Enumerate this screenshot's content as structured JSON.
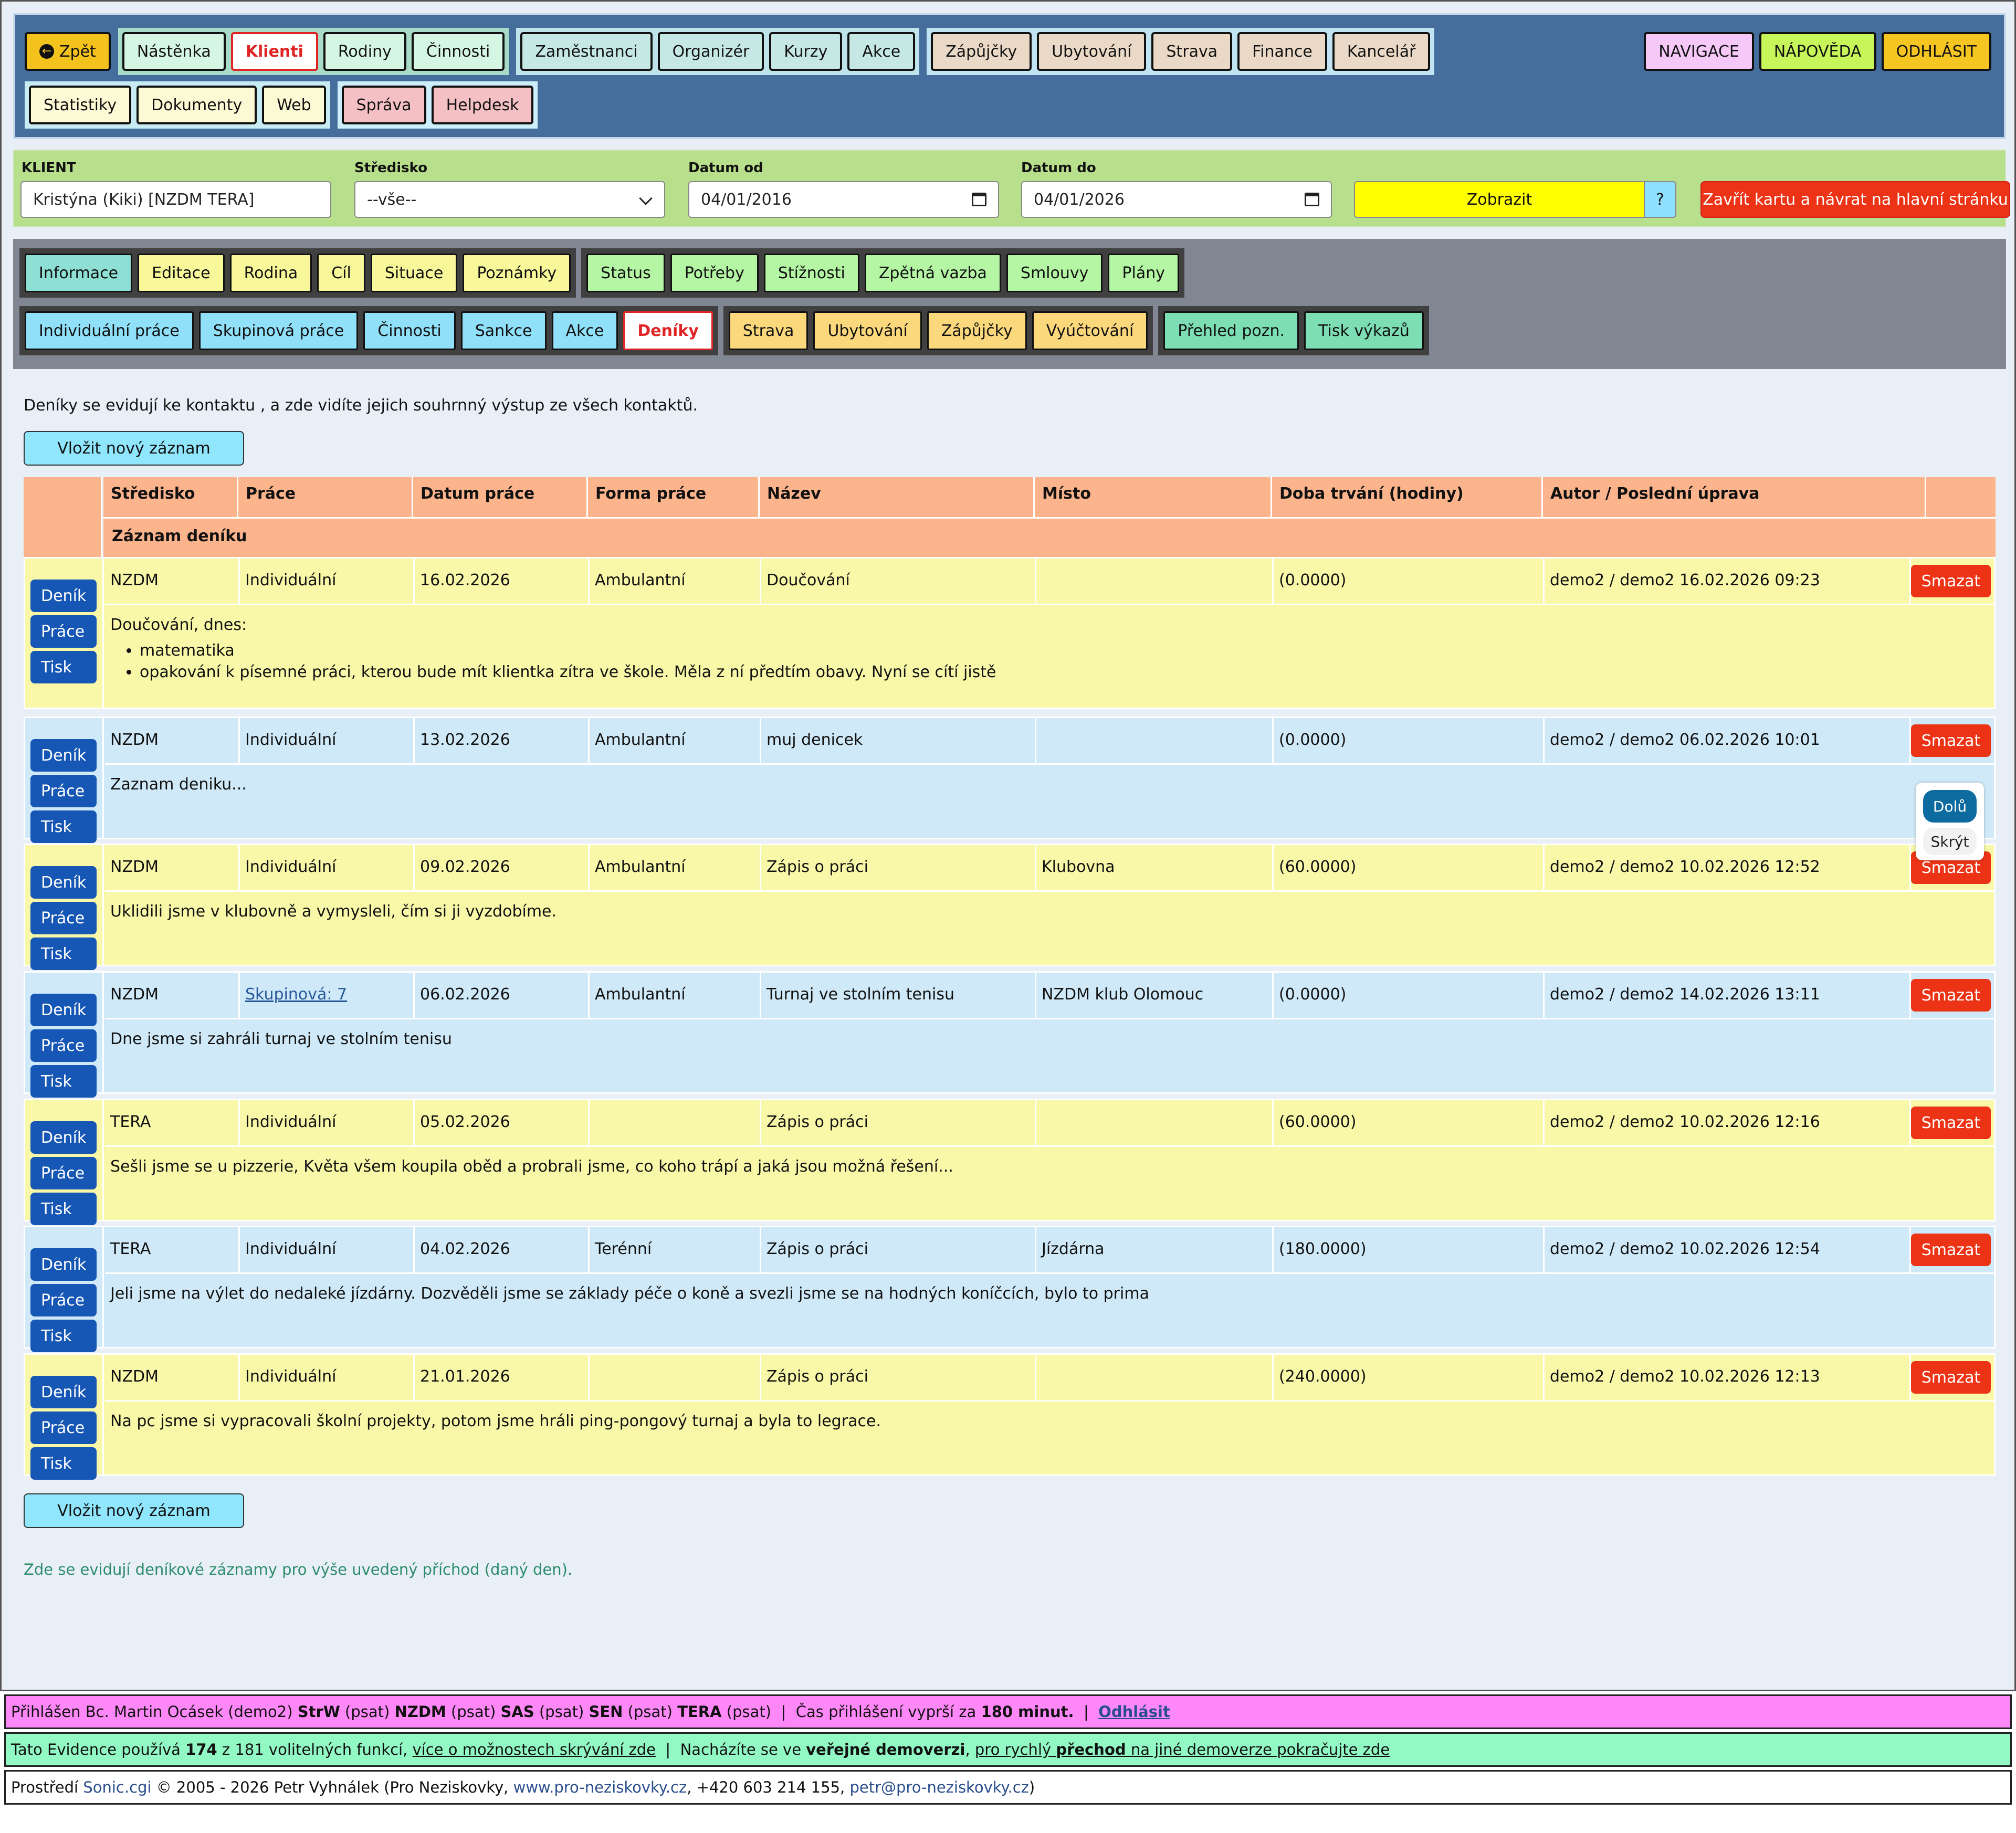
{
  "topnav": {
    "back_label": "Zpět",
    "group1": [
      "Nástěnka",
      "Klienti",
      "Rodiny",
      "Činnosti"
    ],
    "group2": [
      "Zaměstnanci",
      "Organizér",
      "Kurzy",
      "Akce"
    ],
    "group3": [
      "Zápůjčky",
      "Ubytování",
      "Strava",
      "Finance",
      "Kancelář"
    ],
    "row2_group1": [
      "Statistiky",
      "Dokumenty",
      "Web"
    ],
    "row2_group2": [
      "Správa",
      "Helpdesk"
    ],
    "right": [
      "NAVIGACE",
      "NÁPOVĚDA",
      "ODHLÁSIT"
    ]
  },
  "filter": {
    "client_label": "KLIENT",
    "client_value": "Kristýna (Kiki) [NZDM TERA]",
    "center_label": "Středisko",
    "center_value": "--vše--",
    "date_from_label": "Datum od",
    "date_from_value": "04/01/2016",
    "date_to_label": "Datum do",
    "date_to_value": "04/01/2026",
    "show_button": "Zobrazit",
    "help_button": "?",
    "close_button": "Zavřít kartu a návrat na hlavní stránku"
  },
  "tabs": {
    "row1_group1": [
      "Informace",
      "Editace",
      "Rodina",
      "Cíl",
      "Situace",
      "Poznámky"
    ],
    "row1_group2": [
      "Status",
      "Potřeby",
      "Stížnosti",
      "Zpětná vazba",
      "Smlouvy",
      "Plány"
    ],
    "row2_group1": [
      "Individuální práce",
      "Skupinová práce",
      "Činnosti",
      "Sankce",
      "Akce",
      "Deníky"
    ],
    "row2_group2": [
      "Strava",
      "Ubytování",
      "Zápůjčky",
      "Vyúčtování"
    ],
    "row2_group3": [
      "Přehled pozn.",
      "Tisk výkazů"
    ]
  },
  "main": {
    "intro": "Deníky se evidují ke kontaktu , a zde vidíte jejich souhrnný výstup ze všech kontaktů.",
    "insert_button": "Vložit nový záznam",
    "footnote": "Zde se evidují deníkové záznamy pro výše uvedený příchod (daný den)."
  },
  "table": {
    "headers": [
      "Středisko",
      "Práce",
      "Datum práce",
      "Forma práce",
      "Název",
      "Místo",
      "Doba trvání (hodiny)",
      "Autor / Poslední úprava"
    ],
    "subheader": "Záznam deníku",
    "side_buttons": [
      "Deník",
      "Práce",
      "Tisk"
    ],
    "delete_label": "Smazat",
    "rows": [
      {
        "center": "NZDM",
        "work": "Individuální",
        "date": "16.02.2026",
        "form": "Ambulantní",
        "name": "Doučování",
        "place": "",
        "duration": "(0.0000)",
        "author": "demo2 / demo2 16.02.2026 09:23",
        "text": "Doučování, dnes:",
        "bullets": [
          "matematika",
          "opakování k písemné práci, kterou bude mít klientka zítra ve škole. Měla z ní předtím obavy. Nyní se cítí jistě"
        ]
      },
      {
        "center": "NZDM",
        "work": "Individuální",
        "date": "13.02.2026",
        "form": "Ambulantní",
        "name": "muj denicek",
        "place": "",
        "duration": "(0.0000)",
        "author": "demo2 / demo2 06.02.2026 10:01",
        "text": "Zaznam deniku..."
      },
      {
        "center": "NZDM",
        "work": "Individuální",
        "date": "09.02.2026",
        "form": "Ambulantní",
        "name": "Zápis o práci",
        "place": "Klubovna",
        "duration": "(60.0000)",
        "author": "demo2 / demo2 10.02.2026 12:52",
        "text": "Uklidili jsme v klubovně a vymysleli, čím si ji vyzdobíme."
      },
      {
        "center": "NZDM",
        "work": "Skupinová: 7",
        "date": "06.02.2026",
        "form": "Ambulantní",
        "name": "Turnaj ve stolním tenisu",
        "place": "NZDM klub Olomouc",
        "duration": "(0.0000)",
        "author": "demo2 / demo2 14.02.2026 13:11",
        "text": "Dne jsme si zahráli turnaj ve stolním tenisu"
      },
      {
        "center": "TERA",
        "work": "Individuální",
        "date": "05.02.2026",
        "form": "",
        "name": "Zápis o práci",
        "place": "",
        "duration": "(60.0000)",
        "author": "demo2 / demo2 10.02.2026 12:16",
        "text": "Sešli jsme se u pizzerie, Květa všem koupila oběd a probrali jsme, co koho trápí a jaká jsou možná řešení..."
      },
      {
        "center": "TERA",
        "work": "Individuální",
        "date": "04.02.2026",
        "form": "Terénní",
        "name": "Zápis o práci",
        "place": "Jízdárna",
        "duration": "(180.0000)",
        "author": "demo2 / demo2 10.02.2026 12:54",
        "text": "Jeli jsme na výlet do nedaleké jízdárny. Dozvěděli jsme se základy péče o koně a svezli jsme se na hodných koníčcích, bylo to prima"
      },
      {
        "center": "NZDM",
        "work": "Individuální",
        "date": "21.01.2026",
        "form": "",
        "name": "Zápis o práci",
        "place": "",
        "duration": "(240.0000)",
        "author": "demo2 / demo2 10.02.2026 12:13",
        "text": "Na pc jsme si vypracovali školní projekty, potom jsme hráli ping-pongový turnaj a byla to legrace."
      }
    ]
  },
  "float_panel": {
    "down": "Dolů",
    "hide": "Skrýt"
  },
  "footer": {
    "line1": {
      "logged_in": "Přihlášen Bc. Martin Ocásek (demo2)",
      "roles": [
        {
          "code": "StrW",
          "note": "(psat)"
        },
        {
          "code": "NZDM",
          "note": "(psat)"
        },
        {
          "code": "SAS",
          "note": "(psat)"
        },
        {
          "code": "SEN",
          "note": "(psat)"
        },
        {
          "code": "TERA",
          "note": "(psat)"
        }
      ],
      "sep": "|",
      "expire_text": "Čas přihlášení vyprší za",
      "expire_value": "180 minut.",
      "logout": "Odhlásit"
    },
    "line2": {
      "p1": "Tato Evidence používá",
      "used": "174",
      "p2": "z 181 volitelných funkcí,",
      "link1": "více o možnostech skrývání zde",
      "sep": "|",
      "p3": "Nacházíte se ve",
      "public": "veřejné demoverzi",
      "p4": "pro rychlý",
      "switch": "přechod",
      "p5": "na jiné demoverze pokračujte zde"
    },
    "line3": {
      "p1": "Prostředí",
      "product": "Sonic.cgi",
      "p2": "© 2005 - 2026 Petr Vyhnálek (Pro Neziskovky,",
      "web": "www.pro-neziskovky.cz",
      "p3": ", +420 603 214 155,",
      "email": "petr@pro-neziskovky.cz",
      "p4": ")"
    }
  }
}
